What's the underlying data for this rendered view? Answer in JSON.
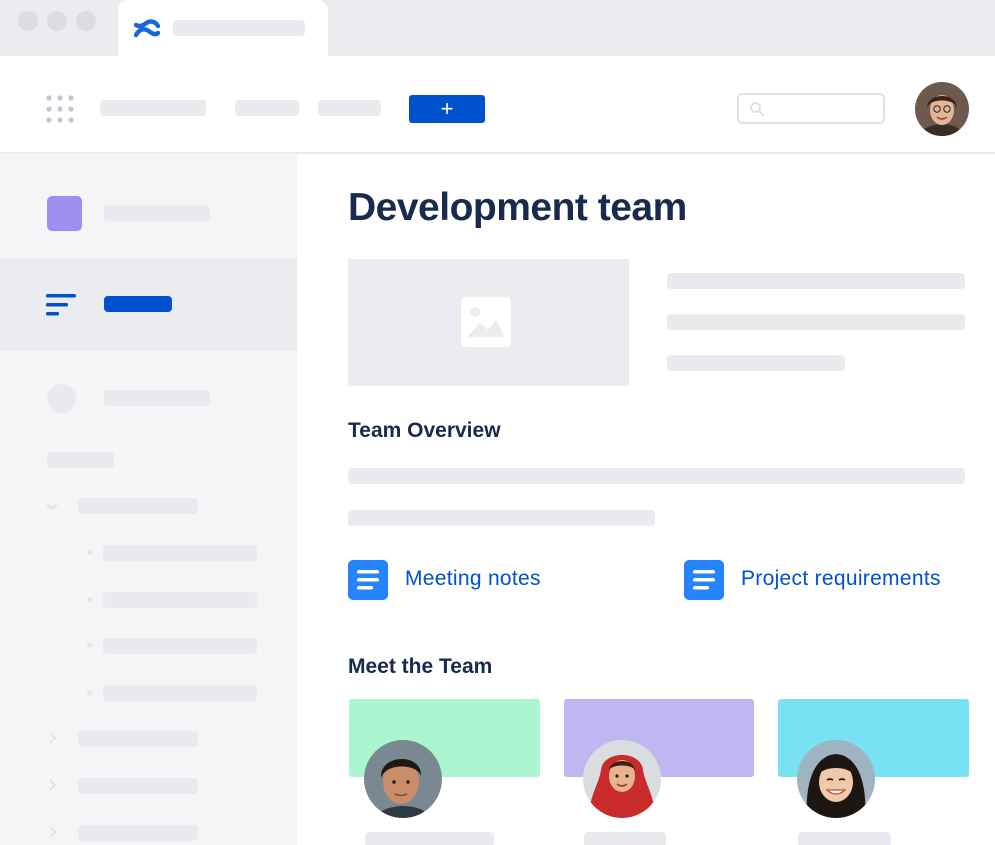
{
  "topnav": {
    "create_label": "+"
  },
  "page": {
    "title": "Development team",
    "team_overview_heading": "Team Overview",
    "meet_team_heading": "Meet the Team"
  },
  "links": [
    {
      "label": "Meeting notes",
      "icon": "document-icon"
    },
    {
      "label": "Project requirements",
      "icon": "document-icon"
    }
  ],
  "colors": {
    "accent": "#0052cc",
    "doc_icon": "#2684ff",
    "title_text": "#172b4d",
    "space_icon": "#9f8fef",
    "card_green": "#abf5d1",
    "card_purple": "#c0b6f2",
    "card_cyan": "#79e2f2"
  }
}
